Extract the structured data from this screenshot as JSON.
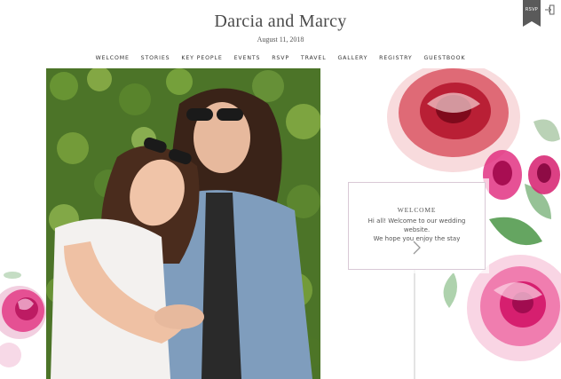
{
  "header": {
    "title": "Darcia and Marcy",
    "date": "August 11, 2018"
  },
  "nav": {
    "items": [
      "WELCOME",
      "STORIES",
      "KEY PEOPLE",
      "EVENTS",
      "RSVP",
      "TRAVEL",
      "GALLERY",
      "REGISTRY",
      "GUESTBOOK"
    ]
  },
  "rsvp_tag": "RSVP",
  "icons": {
    "login": "login-icon",
    "next": "chevron-right-icon"
  },
  "welcome_card": {
    "title": "WELCOME",
    "line1": "Hi all! Welcome to our wedding website.",
    "line2": "We hope you enjoy the stay"
  },
  "colors": {
    "rose_red": "#b3122a",
    "rose_pink": "#e0267a",
    "leaf_green": "#3f8f3a",
    "photo_foliage": "#4f7a2c"
  }
}
